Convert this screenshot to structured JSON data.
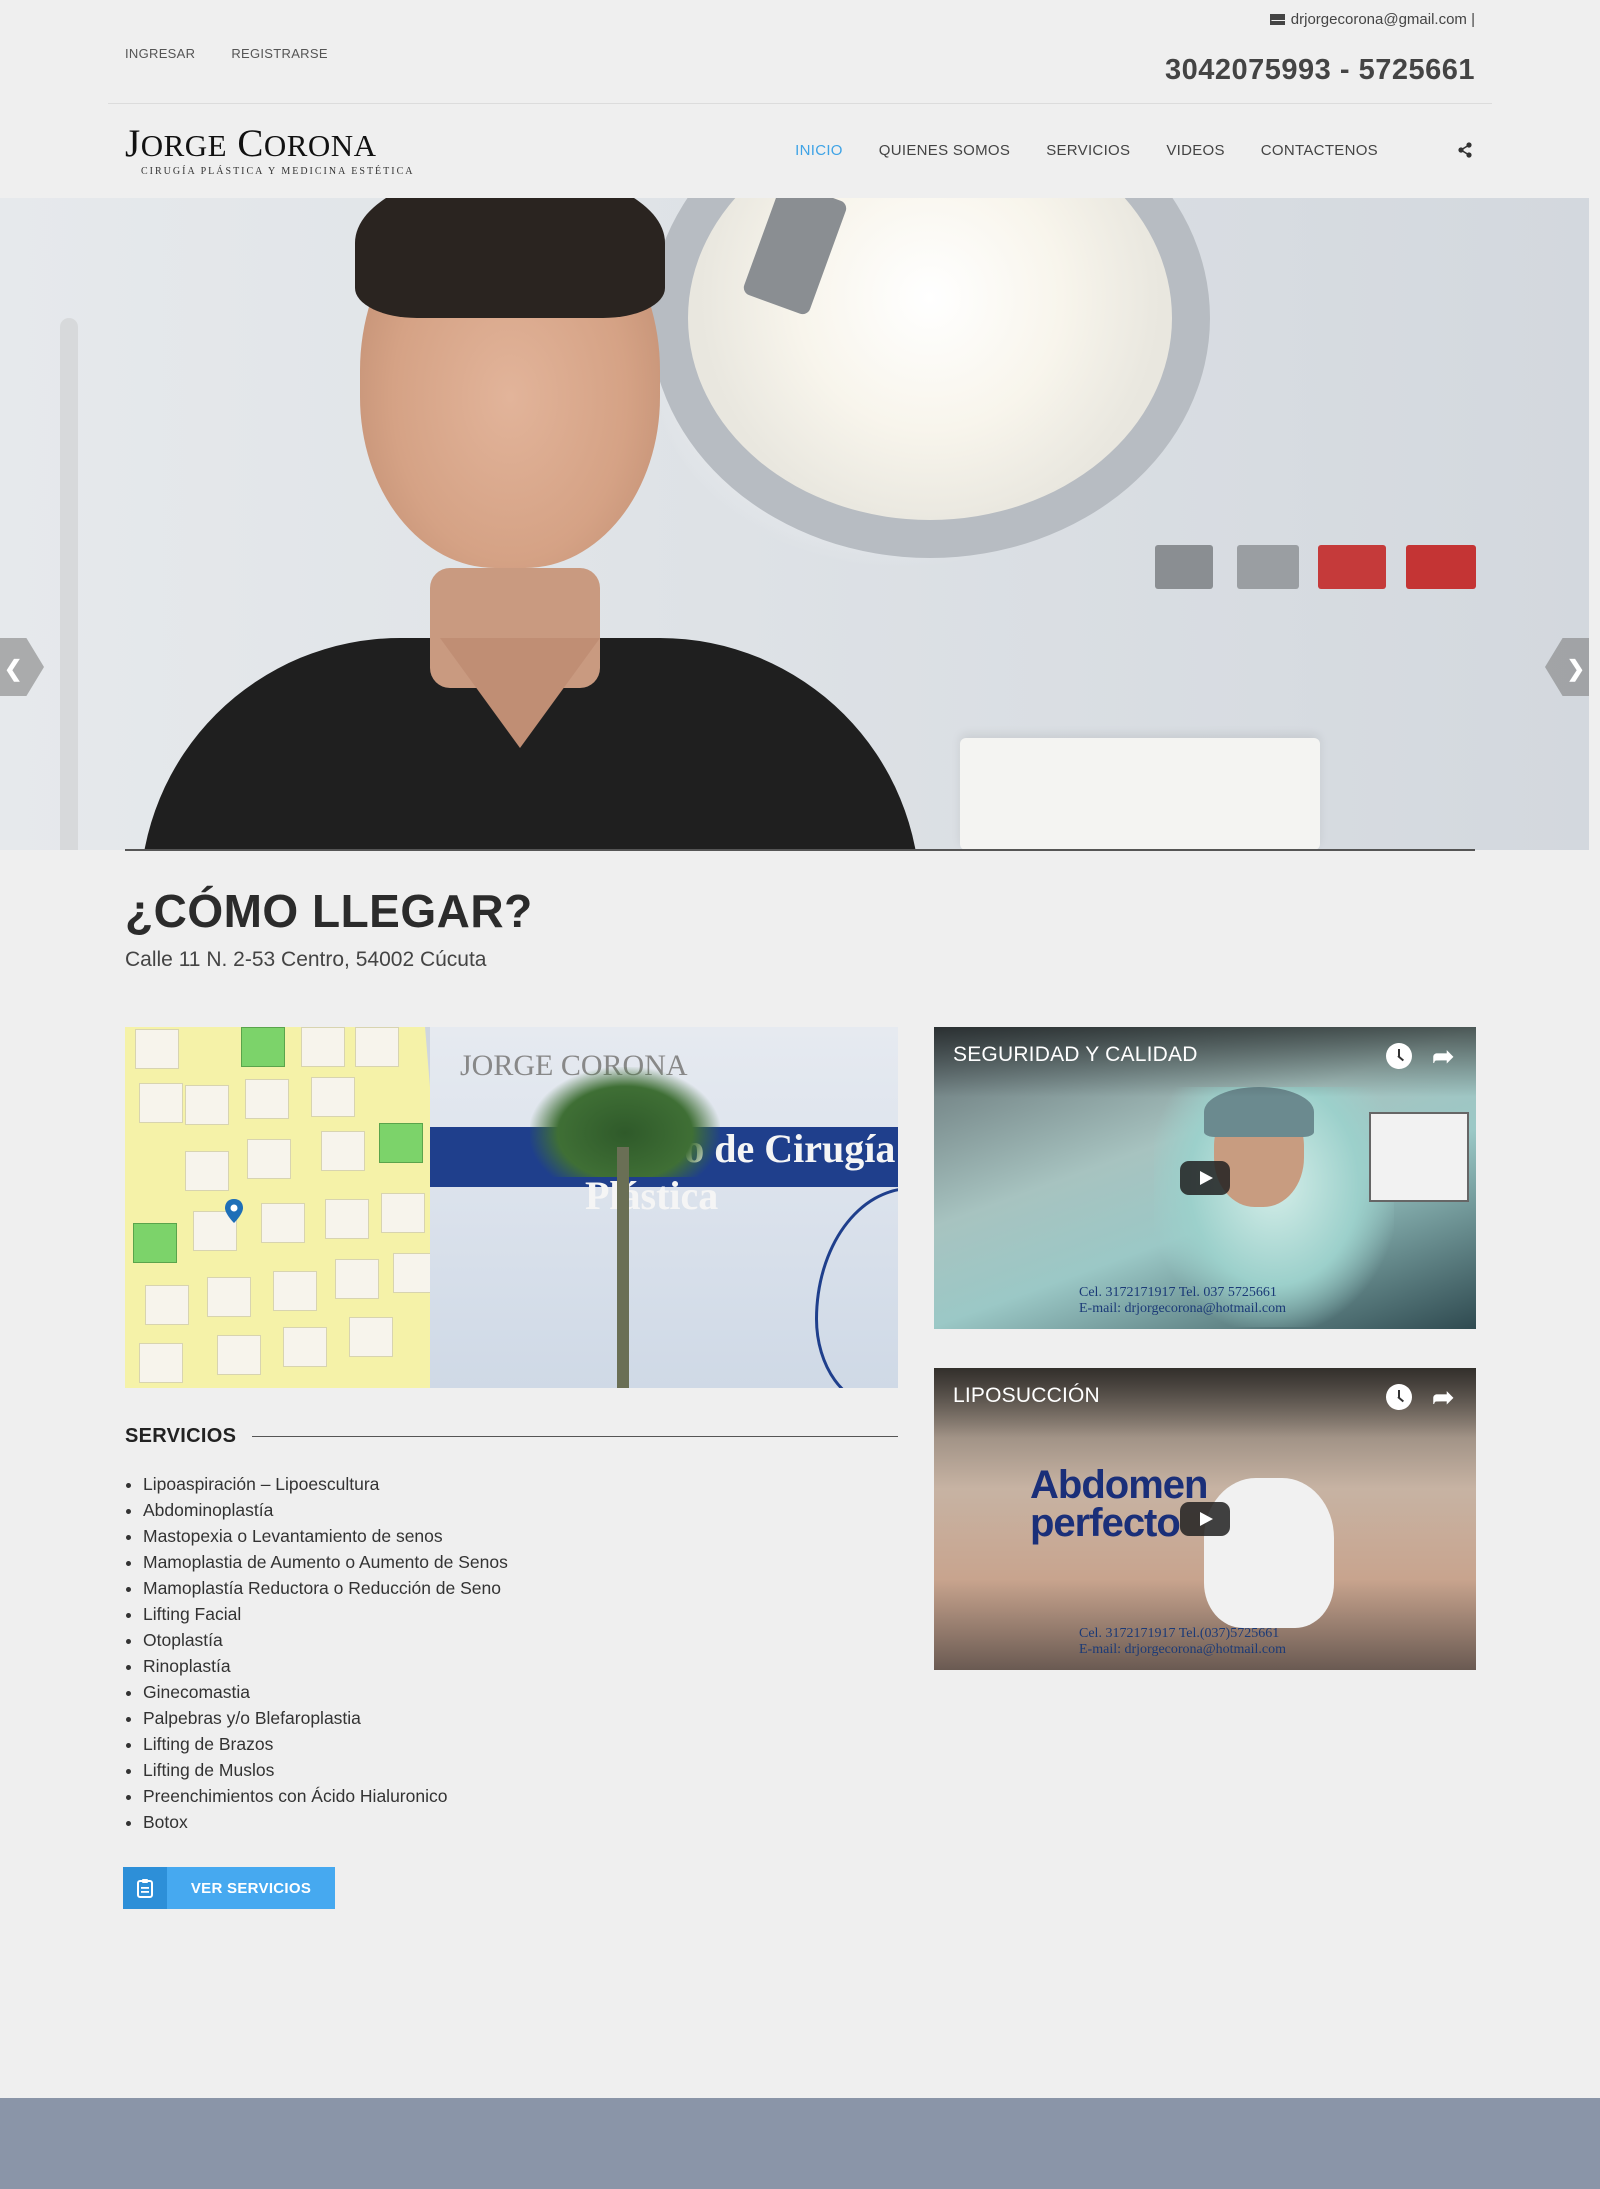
{
  "header": {
    "top_links": [
      "INGRESAR",
      "REGISTRARSE"
    ],
    "email": "drjorgecorona@gmail.com |",
    "phone": "3042075993 - 5725661"
  },
  "logo": {
    "name_first_initial": "J",
    "name_first_rest": "ORGE",
    "name_last_initial": "C",
    "name_last_rest": "ORONA",
    "tagline": "CIRUGÍA PLÁSTICA Y MEDICINA ESTÉTICA"
  },
  "nav": {
    "items": [
      "INICIO",
      "QUIENES SOMOS",
      "SERVICIOS",
      "VIDEOS",
      "CONTACTENOS"
    ],
    "active_index": 0,
    "share_icon": "share-icon"
  },
  "hero": {
    "prev_icon": "chevron-left-icon",
    "next_icon": "chevron-right-icon"
  },
  "location": {
    "title": "¿CÓMO LLEGAR?",
    "address": "Calle 11 N. 2-53 Centro, 54002 Cúcuta",
    "image_sign": "Centro de Cirugía Plástica",
    "image_brand": "JORGE CORONA"
  },
  "services": {
    "heading": "SERVICIOS",
    "items": [
      "Lipoaspiración – Lipoescultura",
      "Abdominoplastía",
      "Mastopexia o Levantamiento de senos",
      "Mamoplastia de Aumento o Aumento de Senos",
      "Mamoplastía Reductora o Reducción de Seno",
      "Lifting Facial",
      "Otoplastía",
      "Rinoplastía",
      "Ginecomastia",
      "Palpebras y/o Blefaroplastia",
      "Lifting de Brazos",
      "Lifting de Muslos",
      "Preenchimientos con Ácido Hialuronico",
      "Botox"
    ],
    "button_label": "VER SERVICIOS",
    "button_icon": "clipboard-icon"
  },
  "videos": [
    {
      "title": "SEGURIDAD Y CALIDAD",
      "caption_line1": "Cel. 3172171917  Tel. 037 5725661",
      "caption_line2": "E-mail: drjorgecorona@hotmail.com"
    },
    {
      "title": "LIPOSUCCIÓN",
      "overlay_line1": "Abdomen",
      "overlay_line2": "perfecto",
      "caption_line1": "Cel. 3172171917  Tel.(037)5725661",
      "caption_line2": "E-mail: drjorgecorona@hotmail.com"
    }
  ],
  "colors": {
    "accent": "#3ea3e6",
    "button": "#46a9f0",
    "footer": "#8a95a8",
    "background": "#efefef"
  }
}
